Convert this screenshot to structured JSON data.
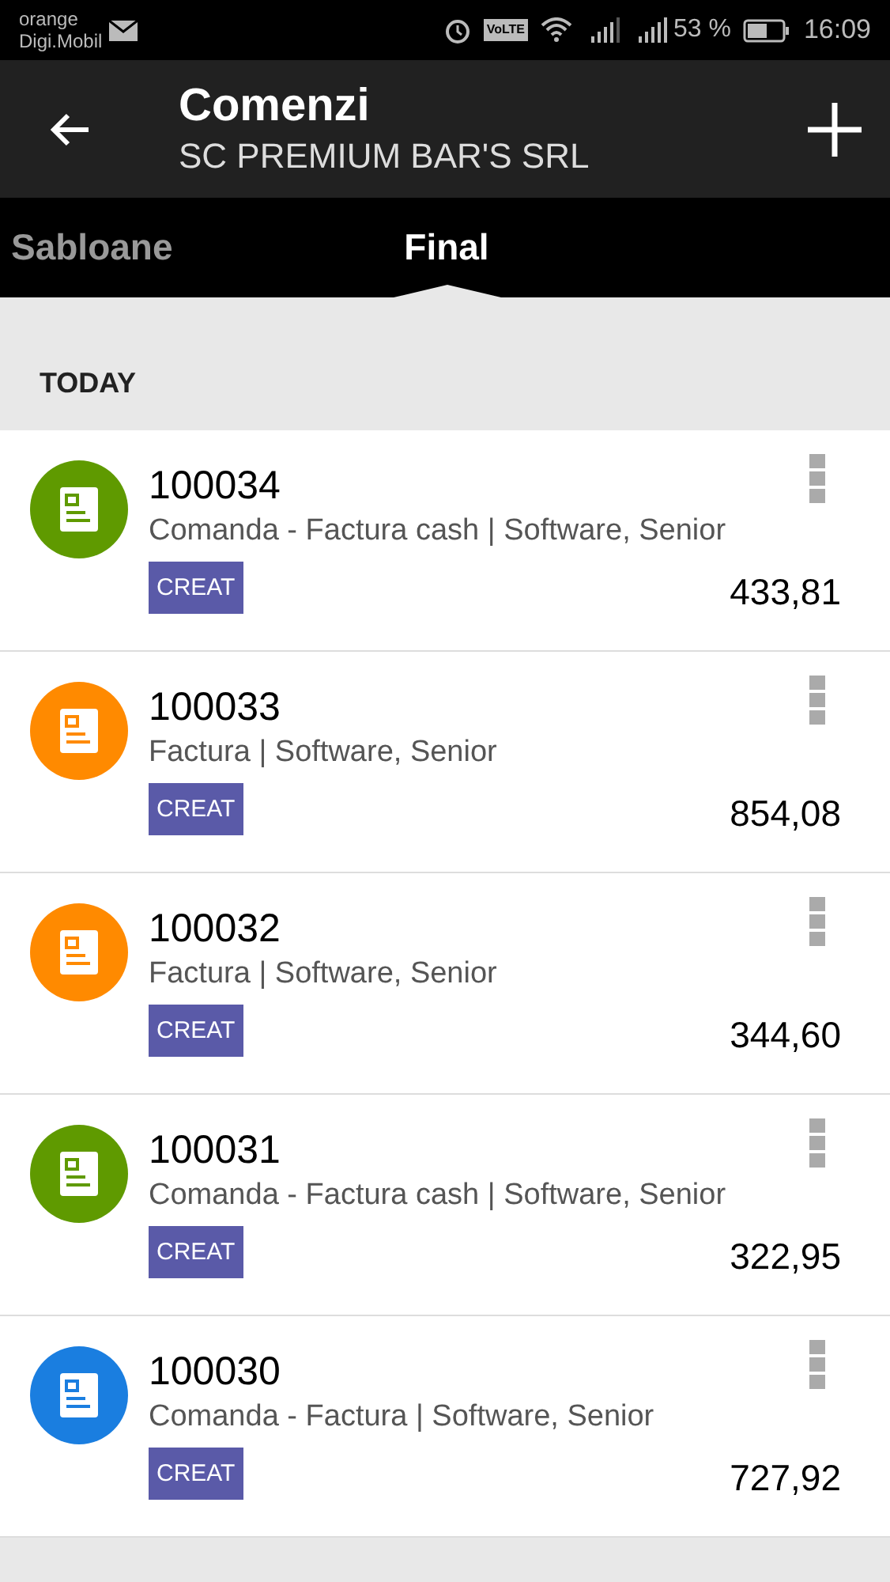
{
  "status_bar": {
    "carrier_1": "orange",
    "carrier_2": "Digi.Mobil",
    "battery_percent": "53 %",
    "time": "16:09",
    "volte": "VoLTE"
  },
  "header": {
    "title": "Comenzi",
    "subtitle": "SC PREMIUM BAR'S SRL"
  },
  "tabs": [
    {
      "label": "Sabloane",
      "selected": false
    },
    {
      "label": "Final",
      "selected": true
    }
  ],
  "section": {
    "title": "TODAY"
  },
  "orders": [
    {
      "number": "100034",
      "description": "Comanda - Factura cash | Software, Senior",
      "status": "CREAT",
      "amount": "433,81",
      "color": "#5f9a00"
    },
    {
      "number": "100033",
      "description": "Factura | Software, Senior",
      "status": "CREAT",
      "amount": "854,08",
      "color": "#ff8a00"
    },
    {
      "number": "100032",
      "description": "Factura | Software, Senior",
      "status": "CREAT",
      "amount": "344,60",
      "color": "#ff8a00"
    },
    {
      "number": "100031",
      "description": "Comanda - Factura cash | Software, Senior",
      "status": "CREAT",
      "amount": "322,95",
      "color": "#5f9a00"
    },
    {
      "number": "100030",
      "description": "Comanda - Factura | Software, Senior",
      "status": "CREAT",
      "amount": "727,92",
      "color": "#1a7ee0"
    }
  ]
}
